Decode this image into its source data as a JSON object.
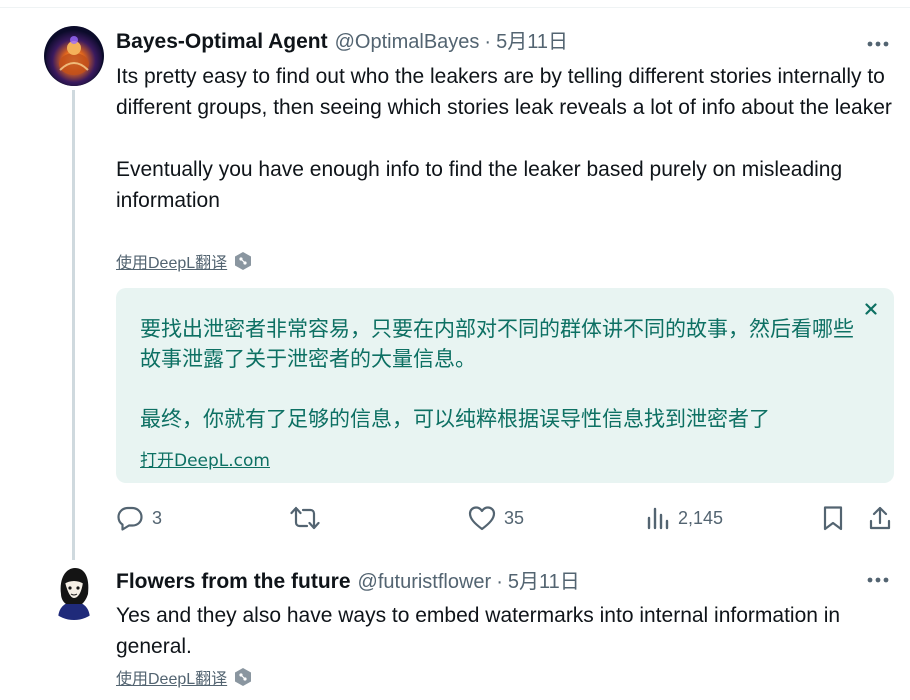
{
  "colors": {
    "text_primary": "#0f1419",
    "text_secondary": "#536471",
    "translation_bg": "#e8f4f2",
    "translation_text": "#0d7063",
    "thread_line": "#cfd9de"
  },
  "tweets": [
    {
      "name": "Bayes-Optimal Agent",
      "handle": "@OptimalBayes",
      "separator": "·",
      "date": "5月11日",
      "avatar_icon": "glowing-figure-avatar",
      "text": "Its pretty easy to find out who the leakers are by telling different stories internally to different groups, then seeing which stories leak reveals a lot of info about the leaker\n\nEventually you have enough info to find the leaker based purely on misleading information",
      "translate_label": "使用DeepL翻译",
      "translation": {
        "text": "要找出泄密者非常容易，只要在内部对不同的群体讲不同的故事，然后看哪些故事泄露了关于泄密者的大量信息。\n\n最终，你就有了足够的信息，可以纯粹根据误导性信息找到泄密者了",
        "open_link": "打开DeepL.com",
        "close_icon": "close-icon"
      },
      "actions": {
        "replies": "3",
        "retweets": "",
        "likes": "35",
        "views": "2,145"
      }
    },
    {
      "name": "Flowers from the future",
      "handle": "@futuristflower",
      "separator": "·",
      "date": "5月11日",
      "avatar_icon": "anime-girl-avatar",
      "text": "Yes and they also have ways to embed watermarks into internal information in general.",
      "translate_label": "使用DeepL翻译"
    }
  ]
}
